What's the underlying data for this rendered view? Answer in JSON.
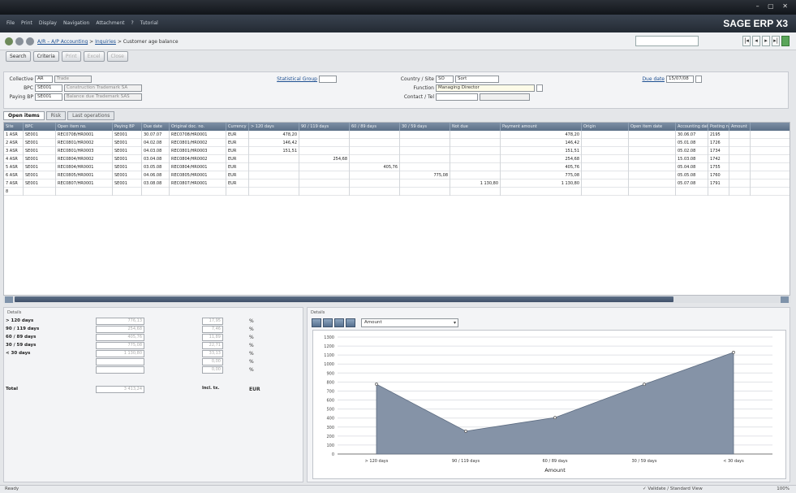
{
  "window": {
    "controls": "– ▢ ✕"
  },
  "menubar": {
    "items": [
      "File",
      "Print",
      "Display",
      "Navigation",
      "Attachment",
      "?",
      "Tutorial"
    ],
    "brand": "SAGE ERP X3"
  },
  "breadcrumb": {
    "part1": "A/R – A/P Accounting",
    "sep": " > ",
    "part2": "Inquiries",
    "part3": " > Customer age balance"
  },
  "toolbar": {
    "buttons": [
      "Search",
      "Criteria",
      "Print",
      "Excel",
      "Close"
    ]
  },
  "form": {
    "collective_label": "Collective",
    "collective_value": "AR",
    "collective_desc": "Trade",
    "bpc_label": "BPC",
    "bpc_value": "SE001",
    "bpc_desc": "Construction Trademark SA",
    "paying_label": "Paying BP",
    "paying_value": "SE001",
    "paying_desc": "Balance due Trademark SAS",
    "stat_group_label": "Statistical Group",
    "country_label": "Country / Site",
    "country_value": "SO",
    "site_value": "Sort",
    "function_label": "Function",
    "function_value": "Managing Director",
    "contact_label": "Contact / Tel",
    "due_label": "Due date",
    "due_value": "15/07/08"
  },
  "tabs": [
    "Open items",
    "Risk",
    "Last operations"
  ],
  "grid": {
    "headers": [
      "Site",
      "BPC",
      "Open item no.",
      "Paying BP",
      "Due date",
      "Original doc. no.",
      "Currency",
      "> 120 days",
      "90 / 119 days",
      "60 / 89 days",
      "30 / 59 days",
      "Not due",
      "Payment amount",
      "Origin",
      "Open item date",
      "Accounting date",
      "Posting no.",
      "Amount"
    ],
    "rows": [
      [
        "1 ASR",
        "SE001",
        "REC0708/HR0001",
        "SE001",
        "30.07.07",
        "REC0708/HR0001",
        "EUR",
        "478,20",
        "",
        "",
        "",
        "",
        "478,20",
        "",
        "",
        "30.06.07",
        "2195",
        ""
      ],
      [
        "2 ASR",
        "SE001",
        "REC0801/HR0002",
        "SE001",
        "04.02.08",
        "REC0801/HR0002",
        "EUR",
        "146,42",
        "",
        "",
        "",
        "",
        "146,42",
        "",
        "",
        "05.01.08",
        "1726",
        ""
      ],
      [
        "3 ASR",
        "SE001",
        "REC0801/HR0003",
        "SE001",
        "04.03.08",
        "REC0801/HR0003",
        "EUR",
        "151,51",
        "",
        "",
        "",
        "",
        "151,51",
        "",
        "",
        "05.02.08",
        "1734",
        ""
      ],
      [
        "4 ASR",
        "SE001",
        "REC0804/HR0002",
        "SE001",
        "03.04.08",
        "REC0804/HR0002",
        "EUR",
        "",
        "254,68",
        "",
        "",
        "",
        "254,68",
        "",
        "",
        "15.03.08",
        "1742",
        ""
      ],
      [
        "5 ASR",
        "SE001",
        "REC0804/HR0001",
        "SE001",
        "03.05.08",
        "REC0804/HR0001",
        "EUR",
        "",
        "",
        "405,76",
        "",
        "",
        "405,76",
        "",
        "",
        "05.04.08",
        "1755",
        ""
      ],
      [
        "6 ASR",
        "SE001",
        "REC0805/HR0001",
        "SE001",
        "04.06.08",
        "REC0805/HR0001",
        "EUR",
        "",
        "",
        "",
        "775,08",
        "",
        "775,08",
        "",
        "",
        "05.05.08",
        "1760",
        ""
      ],
      [
        "7 ASR",
        "SE001",
        "REC0807/HR0001",
        "SE001",
        "03.08.08",
        "REC0807/HR0001",
        "EUR",
        "",
        "",
        "",
        "",
        "1 130,80",
        "1 130,80",
        "",
        "",
        "05.07.08",
        "1791",
        ""
      ],
      [
        "8",
        "",
        "",
        "",
        "",
        "",
        "",
        "",
        "",
        "",
        "",
        "",
        "",
        "",
        "",
        "",
        "",
        ""
      ]
    ]
  },
  "balance": {
    "title": "Details",
    "rows": [
      {
        "label": "> 120 days",
        "amount": "776,13",
        "pct": "17,95",
        "sym": "%"
      },
      {
        "label": "90 / 119 days",
        "amount": "254,68",
        "pct": "7,46",
        "sym": "%"
      },
      {
        "label": "60 / 89 days",
        "amount": "405,76",
        "pct": "11,89",
        "sym": "%"
      },
      {
        "label": "30 / 59 days",
        "amount": "775,08",
        "pct": "22,71",
        "sym": "%"
      },
      {
        "label": "< 30 days",
        "amount": "1 130,80",
        "pct": "33,13",
        "sym": "%"
      },
      {
        "label": "",
        "amount": "",
        "pct": "0,00",
        "sym": "%"
      },
      {
        "label": "",
        "amount": "",
        "pct": "0,00",
        "sym": "%"
      },
      {
        "label": "Total",
        "amount": "3 413,24",
        "pct": "Incl. tx.",
        "sym": "EUR"
      }
    ]
  },
  "chart_panel": {
    "title": "Details",
    "selector": "Amount",
    "selector_arrow": "▾"
  },
  "chart_data": {
    "type": "area",
    "categories": [
      "> 120 days",
      "90 / 119 days",
      "60 / 89 days",
      "30 / 59 days",
      "< 30 days"
    ],
    "series": [
      {
        "name": "Amount",
        "values": [
          776,
          254,
          405,
          775,
          1130
        ]
      }
    ],
    "xlabel": "Amount",
    "ylabel": "",
    "ylim": [
      0,
      1300
    ],
    "yticks": [
      0,
      100,
      200,
      300,
      400,
      500,
      600,
      700,
      800,
      900,
      1000,
      1100,
      1200,
      1300
    ],
    "grid": true,
    "fill_color": "#8593a7"
  },
  "statusbar": {
    "left": "Ready",
    "middle": "✓ Validate / Standard View",
    "right": "100%"
  }
}
